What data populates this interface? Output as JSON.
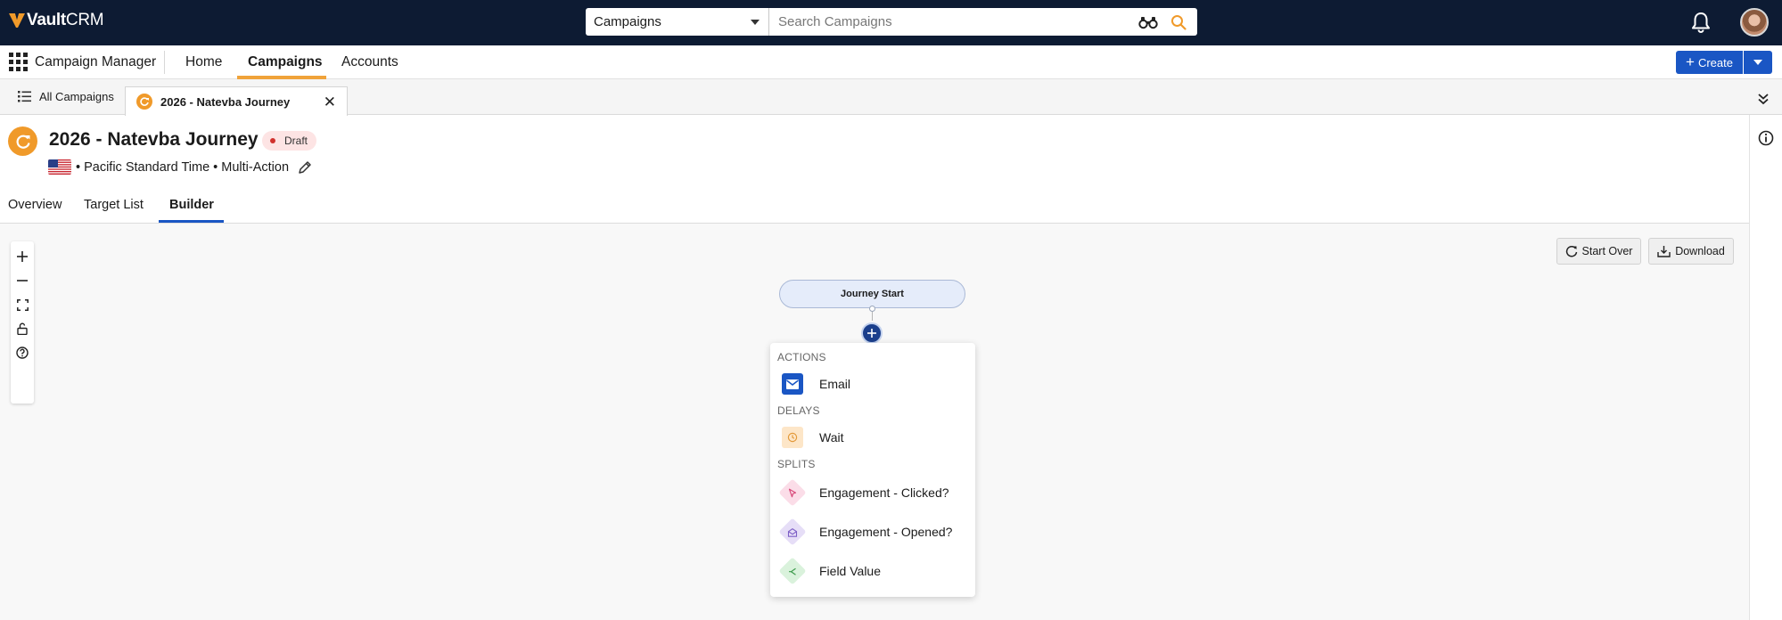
{
  "brand": {
    "vault": "Vault",
    "crm": "CRM"
  },
  "search": {
    "scope": "Campaigns",
    "placeholder": "Search Campaigns"
  },
  "nav": {
    "app_name": "Campaign Manager",
    "items": [
      {
        "label": "Home"
      },
      {
        "label": "Campaigns"
      },
      {
        "label": "Accounts"
      }
    ],
    "active": "Campaigns",
    "create_label": "Create"
  },
  "tabs": {
    "all_label": "All Campaigns",
    "active_label": "2026 - Natevba Journey"
  },
  "page": {
    "title": "2026 - Natevba Journey",
    "status": "Draft",
    "meta": "• Pacific Standard Time • Multi-Action",
    "tabs": [
      {
        "label": "Overview"
      },
      {
        "label": "Target List"
      },
      {
        "label": "Builder"
      }
    ],
    "active_tab": "Builder"
  },
  "canvas": {
    "start_over_label": "Start Over",
    "download_label": "Download",
    "journey_start_label": "Journey Start"
  },
  "menu": {
    "sections": [
      {
        "title": "ACTIONS",
        "items": [
          {
            "label": "Email",
            "icon": "envelope-icon"
          }
        ]
      },
      {
        "title": "DELAYS",
        "items": [
          {
            "label": "Wait",
            "icon": "clock-icon"
          }
        ]
      },
      {
        "title": "SPLITS",
        "items": [
          {
            "label": "Engagement - Clicked?",
            "icon": "cursor-icon"
          },
          {
            "label": "Engagement - Opened?",
            "icon": "open-envelope-icon"
          },
          {
            "label": "Field Value",
            "icon": "branch-icon"
          }
        ]
      }
    ]
  },
  "colors": {
    "topbar": "#0d1b33",
    "accent_orange": "#f09a2a",
    "primary_blue": "#1a56c4",
    "draft_badge_bg": "#fde4e4",
    "draft_dot": "#d0312d"
  }
}
